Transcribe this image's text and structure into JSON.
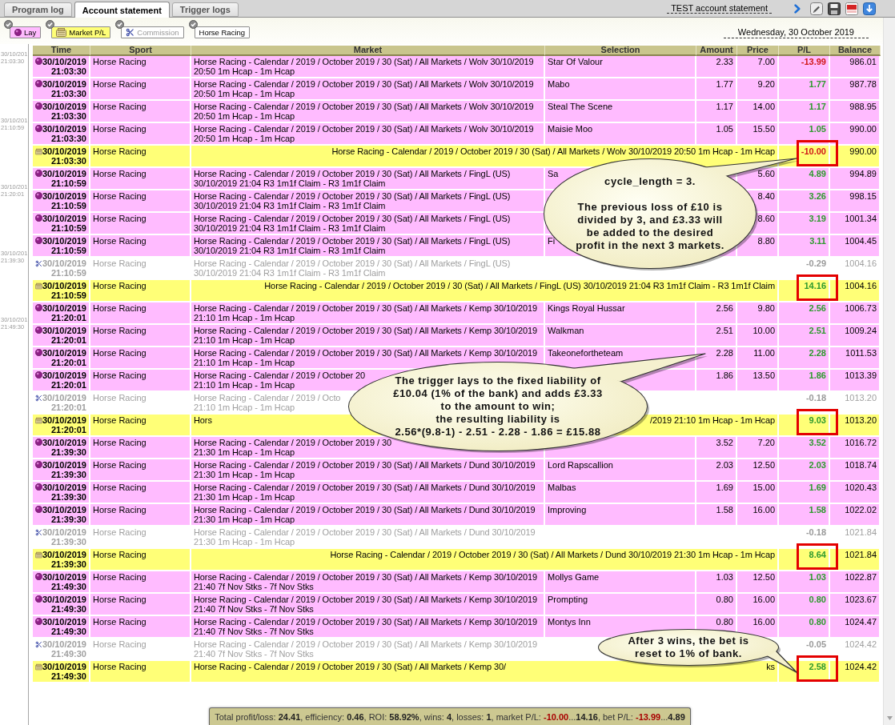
{
  "tabs": [
    {
      "label": "Program log",
      "selected": false
    },
    {
      "label": "Account statement",
      "selected": true
    },
    {
      "label": "Trigger logs",
      "selected": false
    }
  ],
  "report_title": "TEST account statement",
  "filters": [
    {
      "label": "Lay",
      "kind": "lay",
      "checked": true
    },
    {
      "label": "Market P/L",
      "kind": "market",
      "checked": true
    },
    {
      "label": "Commission",
      "kind": "commission",
      "checked": true
    },
    {
      "label": "Horse Racing",
      "kind": "sport",
      "checked": true
    }
  ],
  "date": "Wednesday, 30 October 2019",
  "timeline": [
    {
      "date": "30/10/201",
      "time": "21:03:30"
    },
    {
      "date": "30/10/201",
      "time": "21:10:59"
    },
    {
      "date": "30/10/201",
      "time": "21:20:01"
    },
    {
      "date": "30/10/201",
      "time": "21:39:30"
    },
    {
      "date": "30/10/201",
      "time": "21:49:30"
    }
  ],
  "columns": [
    "Time",
    "Sport",
    "Market",
    "Selection",
    "Amount",
    "Price",
    "P/L",
    "Balance"
  ],
  "rows": [
    {
      "kind": "lay",
      "date": "30/10/2019",
      "time": "21:03:30",
      "sport": "Horse Racing",
      "market": "Horse Racing - Calendar / 2019 / October 2019 / 30 (Sat) / All Markets / Wolv 30/10/2019\n20:50 1m Hcap - 1m Hcap",
      "selection": "Star Of Valour",
      "amount": "2.33",
      "price": "7.00",
      "pl": "-13.99",
      "profit": false,
      "balance": "986.01",
      "highlighted": false
    },
    {
      "kind": "lay",
      "date": "30/10/2019",
      "time": "21:03:30",
      "sport": "Horse Racing",
      "market": "Horse Racing - Calendar / 2019 / October 2019 / 30 (Sat) / All Markets / Wolv 30/10/2019\n20:50 1m Hcap - 1m Hcap",
      "selection": "Mabo",
      "amount": "1.77",
      "price": "9.20",
      "pl": "1.77",
      "profit": true,
      "balance": "987.78",
      "highlighted": false
    },
    {
      "kind": "lay",
      "date": "30/10/2019",
      "time": "21:03:30",
      "sport": "Horse Racing",
      "market": "Horse Racing - Calendar / 2019 / October 2019 / 30 (Sat) / All Markets / Wolv 30/10/2019\n20:50 1m Hcap - 1m Hcap",
      "selection": "Steal The Scene",
      "amount": "1.17",
      "price": "14.00",
      "pl": "1.17",
      "profit": true,
      "balance": "988.95",
      "highlighted": false
    },
    {
      "kind": "lay",
      "date": "30/10/2019",
      "time": "21:03:30",
      "sport": "Horse Racing",
      "market": "Horse Racing - Calendar / 2019 / October 2019 / 30 (Sat) / All Markets / Wolv 30/10/2019\n20:50 1m Hcap - 1m Hcap",
      "selection": "Maisie Moo",
      "amount": "1.05",
      "price": "15.50",
      "pl": "1.05",
      "profit": true,
      "balance": "990.00",
      "highlighted": false
    },
    {
      "kind": "market",
      "date": "30/10/2019",
      "time": "21:03:30",
      "sport": "Horse Racing",
      "market": "Horse Racing - Calendar / 2019 / October 2019 / 30 (Sat) / All Markets / Wolv 30/10/2019 20:50 1m Hcap - 1m Hcap",
      "pl": "-10.00",
      "profit": false,
      "balance": "990.00",
      "highlighted": true
    },
    {
      "kind": "lay",
      "date": "30/10/2019",
      "time": "21:10:59",
      "sport": "Horse Racing",
      "market": "Horse Racing - Calendar / 2019 / October 2019 / 30 (Sat) / All Markets / FingL (US)\n30/10/2019 21:04 R3 1m1f Claim - R3 1m1f Claim",
      "selection": "Sa",
      "price": "5.60",
      "pl": "4.89",
      "profit": true,
      "balance": "994.89",
      "highlighted": false
    },
    {
      "kind": "lay",
      "date": "30/10/2019",
      "time": "21:10:59",
      "sport": "Horse Racing",
      "market": "Horse Racing - Calendar / 2019 / October 2019 / 30 (Sat) / All Markets / FingL (US)\n30/10/2019 21:04 R3 1m1f Claim - R3 1m1f Claim",
      "price": "8.40",
      "pl": "3.26",
      "profit": true,
      "balance": "998.15",
      "highlighted": false
    },
    {
      "kind": "lay",
      "date": "30/10/2019",
      "time": "21:10:59",
      "sport": "Horse Racing",
      "market": "Horse Racing - Calendar / 2019 / October 2019 / 30 (Sat) / All Markets / FingL (US)\n30/10/2019 21:04 R3 1m1f Claim - R3 1m1f Claim",
      "price": "8.60",
      "pl": "3.19",
      "profit": true,
      "balance": "1001.34",
      "highlighted": false
    },
    {
      "kind": "lay",
      "date": "30/10/2019",
      "time": "21:10:59",
      "sport": "Horse Racing",
      "market": "Horse Racing - Calendar / 2019 / October 2019 / 30 (Sat) / All Markets / FingL (US)\n30/10/2019 21:04 R3 1m1f Claim - R3 1m1f Claim",
      "selection": "Fi",
      "price": "8.80",
      "pl": "3.11",
      "profit": true,
      "balance": "1004.45",
      "highlighted": false
    },
    {
      "kind": "commission",
      "date": "30/10/2019",
      "time": "21:10:59",
      "sport": "Horse Racing",
      "market": "Horse Racing - Calendar / 2019 / October 2019 / 30 (Sat) / All Markets / FingL (US)\n30/10/2019 21:04 R3 1m1f Claim - R3 1m1f Claim",
      "pl": "-0.29",
      "balance": "1004.16",
      "highlighted": false
    },
    {
      "kind": "market",
      "date": "30/10/2019",
      "time": "21:10:59",
      "sport": "Horse Racing",
      "market": "Horse Racing - Calendar / 2019 / October 2019 / 30 (Sat) / All Markets / FingL (US) 30/10/2019 21:04 R3 1m1f Claim - R3 1m1f Claim",
      "pl": "14.16",
      "profit": true,
      "balance": "1004.16",
      "highlighted": true
    },
    {
      "kind": "lay",
      "date": "30/10/2019",
      "time": "21:20:01",
      "sport": "Horse Racing",
      "market": "Horse Racing - Calendar / 2019 / October 2019 / 30 (Sat) / All Markets / Kemp 30/10/2019\n21:10 1m Hcap - 1m Hcap",
      "selection": "Kings Royal Hussar",
      "amount": "2.56",
      "price": "9.80",
      "pl": "2.56",
      "profit": true,
      "balance": "1006.73",
      "highlighted": false
    },
    {
      "kind": "lay",
      "date": "30/10/2019",
      "time": "21:20:01",
      "sport": "Horse Racing",
      "market": "Horse Racing - Calendar / 2019 / October 2019 / 30 (Sat) / All Markets / Kemp 30/10/2019\n21:10 1m Hcap - 1m Hcap",
      "selection": "Walkman",
      "amount": "2.51",
      "price": "10.00",
      "pl": "2.51",
      "profit": true,
      "balance": "1009.24",
      "highlighted": false
    },
    {
      "kind": "lay",
      "date": "30/10/2019",
      "time": "21:20:01",
      "sport": "Horse Racing",
      "market": "Horse Racing - Calendar / 2019 / October 2019 / 30 (Sat) / All Markets / Kemp 30/10/2019\n21:10 1m Hcap - 1m Hcap",
      "selection": "Takeonefortheteam",
      "amount": "2.28",
      "price": "11.00",
      "pl": "2.28",
      "profit": true,
      "balance": "1011.53",
      "highlighted": false
    },
    {
      "kind": "lay",
      "date": "30/10/2019",
      "time": "21:20:01",
      "sport": "Horse Racing",
      "market": "Horse Racing - Calendar / 2019 / October 20\n21:10 1m Hcap - 1m Hcap",
      "amount": "1.86",
      "price": "13.50",
      "pl": "1.86",
      "profit": true,
      "balance": "1013.39",
      "highlighted": false
    },
    {
      "kind": "commission",
      "date": "30/10/2019",
      "time": "21:20:01",
      "sport": "Horse Racing",
      "market": "Horse Racing - Calendar / 2019 / Octo\n21:10 1m Hcap - 1m Hcap",
      "pl": "-0.18",
      "balance": "1013.20",
      "highlighted": false
    },
    {
      "kind": "market",
      "date": "30/10/2019",
      "time": "21:20:01",
      "sport": "Horse Racing",
      "market_start": "Hors",
      "market": "/2019 21:10 1m Hcap - 1m Hcap",
      "pl": "9.03",
      "profit": true,
      "balance": "1013.20",
      "highlighted": true
    },
    {
      "kind": "lay",
      "date": "30/10/2019",
      "time": "21:39:30",
      "sport": "Horse Racing",
      "market": "Horse Racing - Calendar / 2019 / October 2019 / 30\n21:30 1m Hcap - 1m Hcap",
      "amount": "3.52",
      "price": "7.20",
      "pl": "3.52",
      "profit": true,
      "balance": "1016.72",
      "highlighted": false
    },
    {
      "kind": "lay",
      "date": "30/10/2019",
      "time": "21:39:30",
      "sport": "Horse Racing",
      "market": "Horse Racing - Calendar / 2019 / October 2019 / 30 (Sat) / All Markets / Dund 30/10/2019\n21:30 1m Hcap - 1m Hcap",
      "selection": "Lord Rapscallion",
      "amount": "2.03",
      "price": "12.50",
      "pl": "2.03",
      "profit": true,
      "balance": "1018.74",
      "highlighted": false
    },
    {
      "kind": "lay",
      "date": "30/10/2019",
      "time": "21:39:30",
      "sport": "Horse Racing",
      "market": "Horse Racing - Calendar / 2019 / October 2019 / 30 (Sat) / All Markets / Dund 30/10/2019\n21:30 1m Hcap - 1m Hcap",
      "selection": "Malbas",
      "amount": "1.69",
      "price": "15.00",
      "pl": "1.69",
      "profit": true,
      "balance": "1020.43",
      "highlighted": false
    },
    {
      "kind": "lay",
      "date": "30/10/2019",
      "time": "21:39:30",
      "sport": "Horse Racing",
      "market": "Horse Racing - Calendar / 2019 / October 2019 / 30 (Sat) / All Markets / Dund 30/10/2019\n21:30 1m Hcap - 1m Hcap",
      "selection": "Improving",
      "amount": "1.58",
      "price": "16.00",
      "pl": "1.58",
      "profit": true,
      "balance": "1022.02",
      "highlighted": false
    },
    {
      "kind": "commission",
      "date": "30/10/2019",
      "time": "21:39:30",
      "sport": "Horse Racing",
      "market": "Horse Racing - Calendar / 2019 / October 2019 / 30 (Sat) / All Markets / Dund 30/10/2019\n21:30 1m Hcap - 1m Hcap",
      "pl": "-0.18",
      "balance": "1021.84",
      "highlighted": false
    },
    {
      "kind": "market",
      "date": "30/10/2019",
      "time": "21:39:30",
      "sport": "Horse Racing",
      "market": "Horse Racing - Calendar / 2019 / October 2019 / 30 (Sat) / All Markets / Dund 30/10/2019 21:30 1m Hcap - 1m Hcap",
      "pl": "8.64",
      "profit": true,
      "balance": "1021.84",
      "highlighted": true
    },
    {
      "kind": "lay",
      "date": "30/10/2019",
      "time": "21:49:30",
      "sport": "Horse Racing",
      "market": "Horse Racing - Calendar / 2019 / October 2019 / 30 (Sat) / All Markets / Kemp 30/10/2019\n21:40 7f Nov Stks - 7f Nov Stks",
      "selection": "Mollys Game",
      "amount": "1.03",
      "price": "12.50",
      "pl": "1.03",
      "profit": true,
      "balance": "1022.87",
      "highlighted": false
    },
    {
      "kind": "lay",
      "date": "30/10/2019",
      "time": "21:49:30",
      "sport": "Horse Racing",
      "market": "Horse Racing - Calendar / 2019 / October 2019 / 30 (Sat) / All Markets / Kemp 30/10/2019\n21:40 7f Nov Stks - 7f Nov Stks",
      "selection": "Prompting",
      "amount": "0.80",
      "price": "16.00",
      "pl": "0.80",
      "profit": true,
      "balance": "1023.67",
      "highlighted": false
    },
    {
      "kind": "lay",
      "date": "30/10/2019",
      "time": "21:49:30",
      "sport": "Horse Racing",
      "market": "Horse Racing - Calendar / 2019 / October 2019 / 30 (Sat) / All Markets / Kemp 30/10/2019\n21:40 7f Nov Stks - 7f Nov Stks",
      "selection": "Montys Inn",
      "amount": "0.80",
      "price": "16.00",
      "pl": "0.80",
      "profit": true,
      "balance": "1024.47",
      "highlighted": false
    },
    {
      "kind": "commission",
      "date": "30/10/2019",
      "time": "21:49:30",
      "sport": "Horse Racing",
      "market": "Horse Racing - Calendar / 2019 / October 2019 / 30 (Sat) / All Markets / Kemp 30/10/2019\n21:40 7f Nov Stks - 7f Nov Stks",
      "pl": "-0.05",
      "balance": "1024.42",
      "highlighted": false
    },
    {
      "kind": "market",
      "date": "30/10/2019",
      "time": "21:49:30",
      "sport": "Horse Racing",
      "market_start": "Horse Racing - Calendar / 2019 / October 2019 / 30 (Sat) / All Markets / Kemp 30/",
      "market": "ks",
      "pl": "2.58",
      "profit": true,
      "balance": "1024.42",
      "highlighted": true
    }
  ],
  "callouts": [
    {
      "text": "cycle_length = 3.\n\nThe previous loss of £10 is\ndivided by 3, and £3.33 will\nbe added to the desired\nprofit in the next 3 markets."
    },
    {
      "text": "The trigger lays to the fixed liability of\n£10.04 (1% of the bank) and adds £3.33\nto the amount to win;\nthe resulting liability is\n2.56*(9.8-1) - 2.51 - 2.28 - 1.86 = £15.88"
    },
    {
      "text": "After 3 wins, the bet is\nreset to 1% of bank."
    }
  ],
  "summary": [
    {
      "text": "Total profit/loss: ",
      "kind": "label"
    },
    {
      "text": "24.41",
      "kind": "value"
    },
    {
      "text": ", efficiency: ",
      "kind": "label"
    },
    {
      "text": "0.46",
      "kind": "value"
    },
    {
      "text": ", ROI: ",
      "kind": "label"
    },
    {
      "text": "58.92%",
      "kind": "value"
    },
    {
      "text": ", wins: ",
      "kind": "label"
    },
    {
      "text": "4",
      "kind": "value"
    },
    {
      "text": ", losses: ",
      "kind": "label"
    },
    {
      "text": "1",
      "kind": "value"
    },
    {
      "text": ", market P/L: ",
      "kind": "label"
    },
    {
      "text": "-10.00",
      "kind": "loss"
    },
    {
      "text": "...",
      "kind": "label"
    },
    {
      "text": "14.16",
      "kind": "value"
    },
    {
      "text": ", bet P/L: ",
      "kind": "label"
    },
    {
      "text": "-13.99",
      "kind": "loss"
    },
    {
      "text": "...",
      "kind": "label"
    },
    {
      "text": "4.89",
      "kind": "value"
    }
  ]
}
